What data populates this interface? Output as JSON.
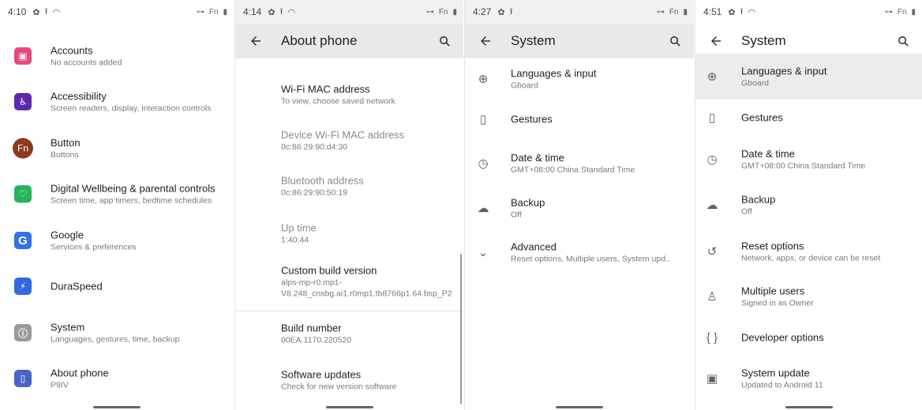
{
  "panel1": {
    "status": {
      "time": "4:10",
      "right": "Fn"
    },
    "items": [
      {
        "title": "Accounts",
        "subtitle": "No accounts added",
        "icon": "account-icon",
        "color": "#e6477c"
      },
      {
        "title": "Accessibility",
        "subtitle": "Screen readers, display, interaction controls",
        "icon": "accessibility-icon",
        "color": "#5c2aad"
      },
      {
        "title": "Button",
        "subtitle": "Buttons",
        "icon": "fn-button-icon",
        "color": "#8b3a1e",
        "glyph": "Fn"
      },
      {
        "title": "Digital Wellbeing & parental controls",
        "subtitle": "Screen time, app timers, bedtime schedules",
        "icon": "wellbeing-icon",
        "color": "#27b35a"
      },
      {
        "title": "Google",
        "subtitle": "Services & preferences",
        "icon": "google-icon",
        "color": "#2f73e6",
        "glyph": "G"
      },
      {
        "title": "DuraSpeed",
        "subtitle": "",
        "icon": "duraspeed-icon",
        "color": "#3368e0"
      },
      {
        "title": "System",
        "subtitle": "Languages, gestures, time, backup",
        "icon": "system-info-icon",
        "color": "#9a9a9a"
      },
      {
        "title": "About phone",
        "subtitle": "P9IV",
        "icon": "phone-icon",
        "color": "#4a63c9"
      }
    ]
  },
  "panel2": {
    "status": {
      "time": "4:14",
      "right": "Fn"
    },
    "title": "About phone",
    "items": [
      {
        "title": "Wi-Fi MAC address",
        "subtitle": "To view, choose saved network"
      },
      {
        "title": "Device Wi-Fi MAC address",
        "subtitle": "0c:86:29:90:d4:30"
      },
      {
        "title": "Bluetooth address",
        "subtitle": "0c:86:29:90:50:19"
      },
      {
        "title": "Up time",
        "subtitle": "1:40:44"
      },
      {
        "title": "Custom build version",
        "subtitle": "alps-mp-r0.mp1-V8.248_cnsbg.ai1.r0mp1.tb8766p1.64.bsp_P2"
      },
      {
        "title": "Build number",
        "subtitle": "00EA.1170.220520"
      },
      {
        "title": "Software updates",
        "subtitle": "Check for new version software"
      }
    ]
  },
  "panel3": {
    "status": {
      "time": "4:27",
      "right": "Fn"
    },
    "title": "System",
    "items": [
      {
        "title": "Languages & input",
        "subtitle": "Gboard",
        "icon": "globe-icon",
        "glyph": "⊕"
      },
      {
        "title": "Gestures",
        "subtitle": "",
        "icon": "gestures-icon",
        "glyph": "▯"
      },
      {
        "title": "Date & time",
        "subtitle": "GMT+08:00 China Standard Time",
        "icon": "clock-icon",
        "glyph": "◷"
      },
      {
        "title": "Backup",
        "subtitle": "Off",
        "icon": "cloud-backup-icon",
        "glyph": "☁"
      },
      {
        "title": "Advanced",
        "subtitle": "Reset options, Multiple users, System upd..",
        "icon": "chevron-down-icon",
        "glyph": "⌄"
      }
    ]
  },
  "panel4": {
    "status": {
      "time": "4:51",
      "right": "Fn"
    },
    "title": "System",
    "items": [
      {
        "title": "Languages & input",
        "subtitle": "Gboard",
        "icon": "globe-icon",
        "glyph": "⊕"
      },
      {
        "title": "Gestures",
        "subtitle": "",
        "icon": "gestures-icon",
        "glyph": "▯"
      },
      {
        "title": "Date & time",
        "subtitle": "GMT+08:00 China Standard Time",
        "icon": "clock-icon",
        "glyph": "◷"
      },
      {
        "title": "Backup",
        "subtitle": "Off",
        "icon": "cloud-backup-icon",
        "glyph": "☁"
      },
      {
        "title": "Reset options",
        "subtitle": "Network, apps, or device can be reset",
        "icon": "reset-icon",
        "glyph": "↺"
      },
      {
        "title": "Multiple users",
        "subtitle": "Signed in as Owner",
        "icon": "user-icon",
        "glyph": "♙"
      },
      {
        "title": "Developer options",
        "subtitle": "",
        "icon": "braces-icon",
        "glyph": "{ }"
      },
      {
        "title": "System update",
        "subtitle": "Updated to Android 11",
        "icon": "system-update-icon",
        "glyph": "▣"
      }
    ]
  }
}
